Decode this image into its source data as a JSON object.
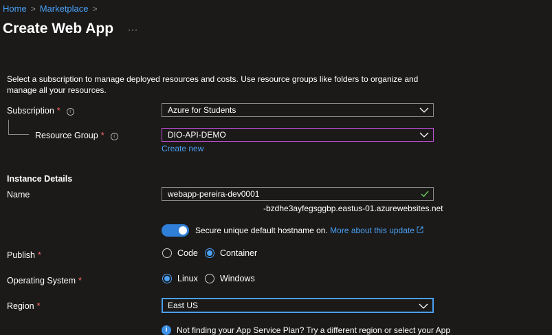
{
  "breadcrumb": {
    "home": "Home",
    "separator": ">",
    "marketplace": "Marketplace"
  },
  "page": {
    "title": "Create Web App",
    "more": "···"
  },
  "description": "Select a subscription to manage deployed resources and costs. Use resource groups like folders to organize and manage all your resources.",
  "subscription": {
    "label": "Subscription",
    "required": "*",
    "value": "Azure for Students"
  },
  "resource_group": {
    "label": "Resource Group",
    "required": "*",
    "value": "DIO-API-DEMO",
    "create_new": "Create new"
  },
  "instance_details": {
    "heading": "Instance Details",
    "name_label": "Name",
    "name_value": "webapp-pereira-dev0001",
    "hostname_suffix": "-bzdhe3ayfegsggbp.eastus-01.azurewebsites.net"
  },
  "secure_hostname": {
    "text": "Secure unique default hostname on.",
    "link": "More about this update",
    "enabled": true
  },
  "publish": {
    "label": "Publish",
    "required": "*",
    "options": [
      "Code",
      "Container"
    ],
    "selected": "Container"
  },
  "os": {
    "label": "Operating System",
    "required": "*",
    "options": [
      "Linux",
      "Windows"
    ],
    "selected": "Linux"
  },
  "region": {
    "label": "Region",
    "required": "*",
    "value": "East US"
  },
  "info_note": "Not finding your App Service Plan? Try a different region or select your App",
  "colors": {
    "accent": "#4aa0f5",
    "required": "#ff6b6b",
    "focus_border": "#c34fd6",
    "background": "#1b1a19"
  }
}
